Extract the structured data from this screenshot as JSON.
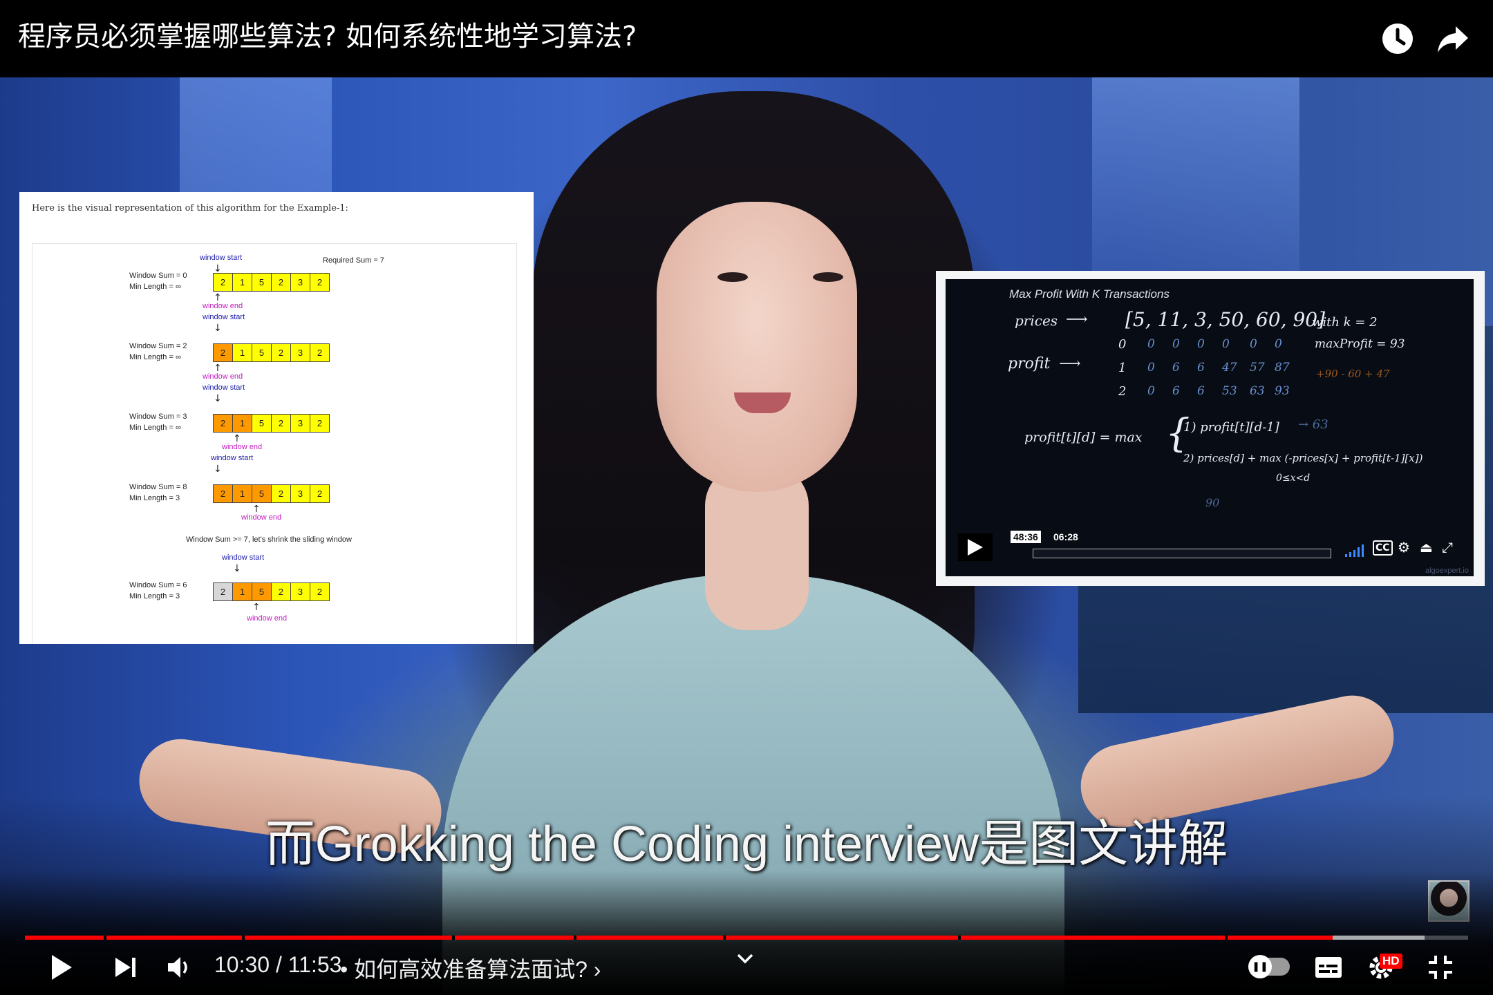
{
  "header": {
    "title": "程序员必须掌握哪些算法? 如何系统性地学习算法?",
    "watch_later_icon": "clock-icon",
    "share_icon": "share-arrow-icon"
  },
  "article": {
    "caption": "Here is the visual representation of this algorithm for the Example-1:",
    "required_sum": "Required Sum = 7",
    "window_start": "window start",
    "window_end": "window end",
    "shrink_note": "Window Sum >= 7, let's shrink the sliding window",
    "steps": [
      {
        "sum": "Window Sum = 0",
        "min": "Min Length = ∞",
        "cells": [
          "2",
          "1",
          "5",
          "2",
          "3",
          "2"
        ]
      },
      {
        "sum": "Window Sum = 2",
        "min": "Min Length = ∞",
        "cells": [
          "2",
          "1",
          "5",
          "2",
          "3",
          "2"
        ]
      },
      {
        "sum": "Window Sum = 3",
        "min": "Min Length = ∞",
        "cells": [
          "2",
          "1",
          "5",
          "2",
          "3",
          "2"
        ]
      },
      {
        "sum": "Window Sum = 8",
        "min": "Min Length = 3",
        "cells": [
          "2",
          "1",
          "5",
          "2",
          "3",
          "2"
        ]
      },
      {
        "sum": "Window Sum = 6",
        "min": "Min Length = 3",
        "cells": [
          "2",
          "1",
          "5",
          "2",
          "3",
          "2"
        ]
      }
    ]
  },
  "embed": {
    "title": "Max Profit With K Transactions",
    "prices_label": "prices",
    "prices": "[5, 11, 3, 50, 60, 90]",
    "with_k": "with k = 2",
    "max_profit": "maxProfit = 93",
    "profit_label": "profit",
    "rows": [
      {
        "idx": "0",
        "vals": [
          "0",
          "0",
          "0",
          "0",
          "0",
          "0"
        ]
      },
      {
        "idx": "1",
        "vals": [
          "0",
          "6",
          "6",
          "47",
          "57",
          "87"
        ]
      },
      {
        "idx": "2",
        "vals": [
          "0",
          "6",
          "6",
          "53",
          "63",
          "93"
        ]
      }
    ],
    "annotation": "+90 - 60 + 47",
    "formula": "profit[t][d] = max",
    "case1": "1) profit[t][d-1]",
    "case1_val": "→ 63",
    "case2": "2) prices[d] + max (-prices[x] + profit[t-1][x])",
    "range": "0≤x<d",
    "scrap": "90",
    "total_time": "48:36",
    "current_time": "06:28",
    "brand": "algoexpert.io"
  },
  "subtitle": "而Grokking the Coding interview是图文讲解",
  "player": {
    "time": "10:30 / 11:53",
    "chapter": "• 如何高效准备算法面试? ›",
    "progress_fraction": 0.906,
    "buffered_fraction": 0.97,
    "hd": "HD",
    "accent": "#ff0000"
  }
}
